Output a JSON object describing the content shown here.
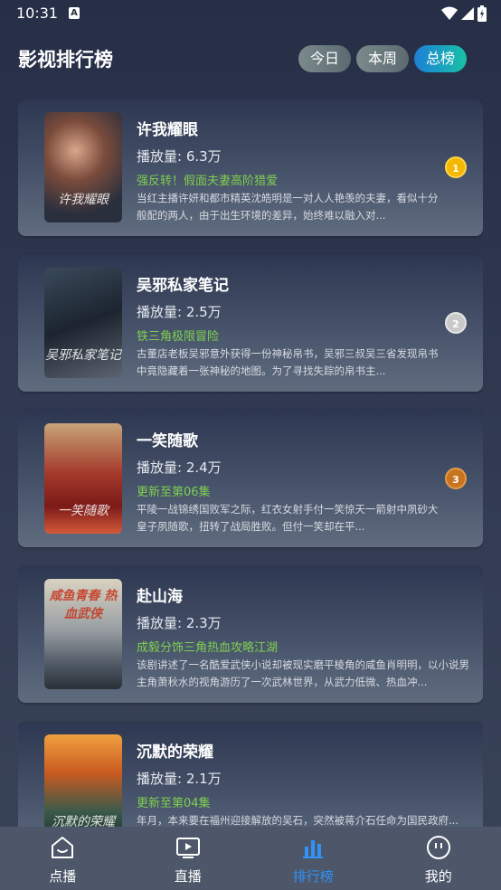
{
  "status_bar": {
    "time": "10:31"
  },
  "header": {
    "title": "影视排行榜",
    "tabs": [
      {
        "label": "今日",
        "active": false
      },
      {
        "label": "本周",
        "active": false
      },
      {
        "label": "总榜",
        "active": true
      }
    ]
  },
  "items": [
    {
      "title": "许我耀眼",
      "plays": "播放量: 6.3万",
      "tag": "强反转！假面夫妻高阶猎爱",
      "desc": "当红主播许妍和都市精英沈皓明是一对人人艳羡的夫妻，看似十分般配的两人，由于出生环境的差异，始终难以融入对...",
      "rank": "1",
      "rank_color": "#f5b700",
      "poster_text": "许我耀眼"
    },
    {
      "title": "吴邪私家笔记",
      "plays": "播放量: 2.5万",
      "tag": "铁三角极限冒险",
      "desc": "古董店老板吴邪意外获得一份神秘帛书，吴邪三叔吴三省发现帛书中竟隐藏着一张神秘的地图。为了寻找失踪的帛书主...",
      "rank": "2",
      "rank_color": "#c9c9c9",
      "poster_text": "吴邪私家笔记"
    },
    {
      "title": "一笑随歌",
      "plays": "播放量: 2.4万",
      "tag": "更新至第06集",
      "desc": "        平陵一战锦绣国败军之际，红衣女射手付一笑惊天一箭射中夙砂大皇子夙随歌，扭转了战局胜败。但付一笑却在平...",
      "rank": "3",
      "rank_color": "#c8741e",
      "poster_text": "一笑随歌"
    },
    {
      "title": "赴山海",
      "plays": "播放量: 2.3万",
      "tag": "成毅分饰三角热血攻略江湖",
      "desc": "该剧讲述了一名酷爱武侠小说却被现实磨平棱角的咸鱼肖明明，以小说男主角萧秋水的视角游历了一次武林世界，从武力低微、热血冲...",
      "rank": "",
      "rank_color": "",
      "poster_text": "咸鱼青春 热血武侠"
    },
    {
      "title": "沉默的荣耀",
      "plays": "播放量: 2.1万",
      "tag": "更新至第04集",
      "desc": "年月，本来要在福州迎接解放的吴石，突然被蒋介石任命为国民政府...",
      "rank": "",
      "rank_color": "",
      "poster_text": "沉默的荣耀"
    }
  ],
  "nav": [
    {
      "label": "点播",
      "icon": "home-icon",
      "active": false
    },
    {
      "label": "直播",
      "icon": "live-tv-icon",
      "active": false
    },
    {
      "label": "排行榜",
      "icon": "ranking-chart-icon",
      "active": true
    },
    {
      "label": "我的",
      "icon": "profile-face-icon",
      "active": false
    }
  ],
  "colors": {
    "accent": "#2f93f5",
    "tag_green": "#7ed04f"
  }
}
